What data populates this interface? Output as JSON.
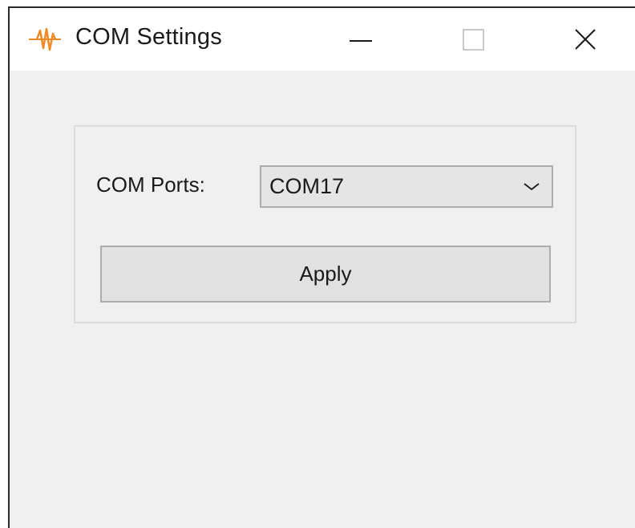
{
  "window": {
    "title": "COM Settings",
    "app_icon": "waveform-icon",
    "controls": {
      "minimize_icon": "minimize-icon",
      "maximize_icon": "maximize-icon",
      "close_icon": "close-icon"
    }
  },
  "form": {
    "ports_label": "COM Ports:",
    "ports_selected": "COM17",
    "apply_label": "Apply"
  },
  "colors": {
    "window_bg": "#f0f0f0",
    "titlebar_bg": "#ffffff",
    "icon_accent": "#f08a24",
    "control_bg": "#e1e1e1",
    "control_border": "#adadad"
  }
}
